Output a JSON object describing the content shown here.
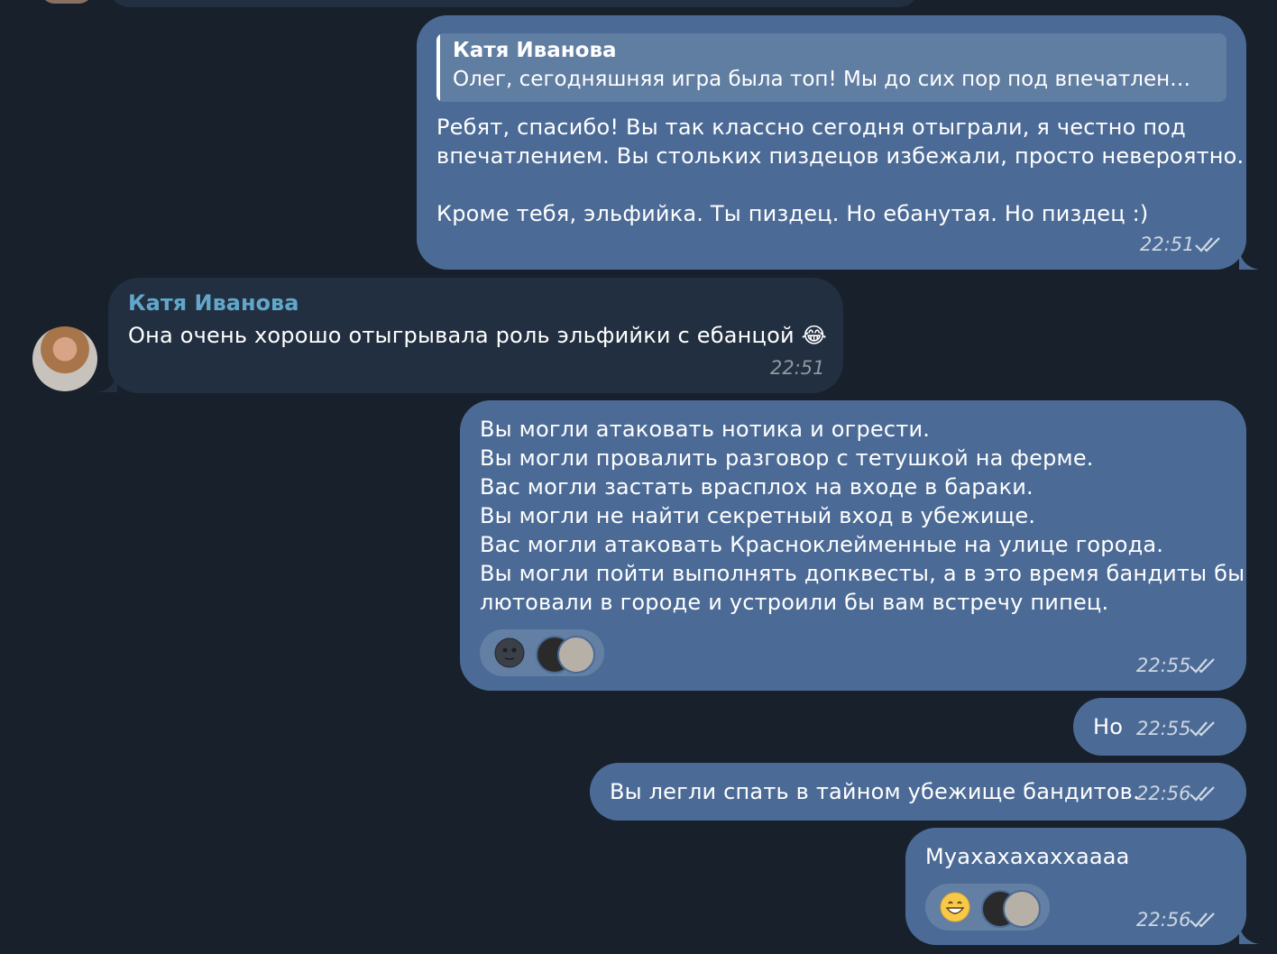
{
  "messages": [
    {
      "reply": {
        "name": "Катя Иванова",
        "text": "Олег, сегодняшняя игра была топ! Мы до сих пор под впечатлен…"
      },
      "text": "Ребят, спасибо! Вы так классно сегодня отыграли, я честно под\nвпечатлением. Вы стольких пиздецов избежали, просто невероятно.\n\nКроме тебя, эльфийка. Ты пиздец. Но ебанутая. Но пиздец :)",
      "time": "22:51"
    },
    {
      "sender": "Катя Иванова",
      "text": "Она очень хорошо отыгрывала роль эльфийки с ебанцой 😂",
      "time": "22:51"
    },
    {
      "text": "Вы могли атаковать нотика и огрести.\nВы могли провалить разговор с тетушкой на ферме.\nВас могли застать врасплох на входе в бараки.\nВы могли не найти секретный вход в убежище.\nВас могли атаковать Красноклейменные на улице города.\nВы могли пойти выполнять допквесты, а в это время бандиты бы\nлютовали в городе и устроили бы вам встречу пипец.",
      "time": "22:55",
      "reaction": "new-moon-face-emoji"
    },
    {
      "text": "Но",
      "time": "22:55"
    },
    {
      "text": "Вы легли спать в тайном убежище бандитов.",
      "time": "22:56"
    },
    {
      "text": "Муахахахаххаааа",
      "time": "22:56",
      "reaction": "grinning-face-emoji"
    }
  ],
  "colors": {
    "background": "#18202b",
    "outgoing_bubble": "#4b6b96",
    "incoming_bubble": "#222f40",
    "sender_name": "#62a7c9"
  }
}
